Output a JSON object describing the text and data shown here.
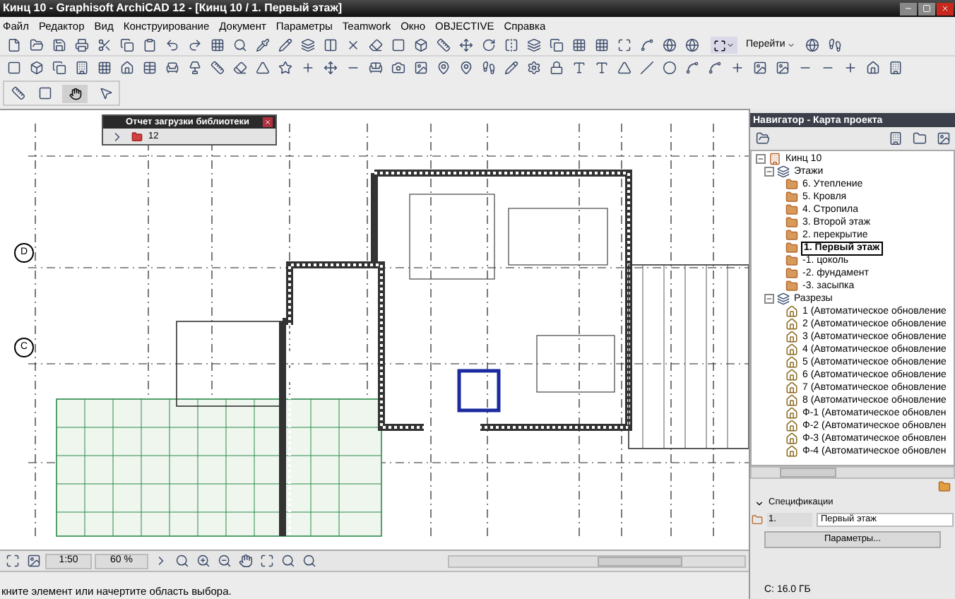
{
  "window": {
    "title": "Кинц 10 - Graphisoft ArchiCAD 12 - [Кинц 10 / 1. Первый этаж]"
  },
  "menu": [
    "Файл",
    "Редактор",
    "Вид",
    "Конструирование",
    "Документ",
    "Параметры",
    "Teamwork",
    "Окно",
    "OBJECTIVE",
    "Справка"
  ],
  "toolbar": {
    "goto": "Перейти"
  },
  "library_report": {
    "title": "Отчет загрузки библиотеки",
    "count": "12"
  },
  "grid_axes": [
    "D",
    "C"
  ],
  "navigator": {
    "title": "Навигатор - Карта проекта",
    "tree": [
      {
        "label": "Кинц 10",
        "kind": "project",
        "expanded": true,
        "children": [
          {
            "label": "Этажи",
            "kind": "group",
            "expanded": true,
            "children": [
              {
                "label": "6. Утепление",
                "kind": "story",
                "selected": false
              },
              {
                "label": "5. Кровля",
                "kind": "story",
                "selected": false
              },
              {
                "label": "4. Стропила",
                "kind": "story",
                "selected": false
              },
              {
                "label": "3. Второй этаж",
                "kind": "story",
                "selected": false
              },
              {
                "label": "2. перекрытие",
                "kind": "story",
                "selected": false
              },
              {
                "label": "1. Первый этаж",
                "kind": "story",
                "selected": true
              },
              {
                "label": "-1. цоколь",
                "kind": "story",
                "selected": false
              },
              {
                "label": "-2. фундамент",
                "kind": "story",
                "selected": false
              },
              {
                "label": "-3. засыпка",
                "kind": "story",
                "selected": false
              }
            ]
          },
          {
            "label": "Разрезы",
            "kind": "group",
            "expanded": true,
            "children": [
              {
                "label": "1 (Автоматическое обновление",
                "kind": "section",
                "selected": false
              },
              {
                "label": "2 (Автоматическое обновление",
                "kind": "section",
                "selected": false
              },
              {
                "label": "3 (Автоматическое обновление",
                "kind": "section",
                "selected": false
              },
              {
                "label": "4 (Автоматическое обновление",
                "kind": "section",
                "selected": false
              },
              {
                "label": "5 (Автоматическое обновление",
                "kind": "section",
                "selected": false
              },
              {
                "label": "6 (Автоматическое обновление",
                "kind": "section",
                "selected": false
              },
              {
                "label": "7 (Автоматическое обновление",
                "kind": "section",
                "selected": false
              },
              {
                "label": "8 (Автоматическое обновление",
                "kind": "section",
                "selected": false
              },
              {
                "label": "Ф-1 (Автоматическое обновлен",
                "kind": "section",
                "selected": false
              },
              {
                "label": "Ф-2 (Автоматическое обновлен",
                "kind": "section",
                "selected": false
              },
              {
                "label": "Ф-3 (Автоматическое обновлен",
                "kind": "section",
                "selected": false
              },
              {
                "label": "Ф-4 (Автоматическое обновлен",
                "kind": "section",
                "selected": false
              }
            ]
          }
        ]
      }
    ]
  },
  "specifications": {
    "title": "Спецификации",
    "expanded": true,
    "number": "1.",
    "name": "Первый этаж",
    "button": "Параметры..."
  },
  "disk": "C: 16.0 ГБ",
  "view_bar": {
    "scale": "1:50",
    "zoom": "60 %"
  },
  "status_bar": {
    "message": "кните элемент или начертите область выбора."
  }
}
